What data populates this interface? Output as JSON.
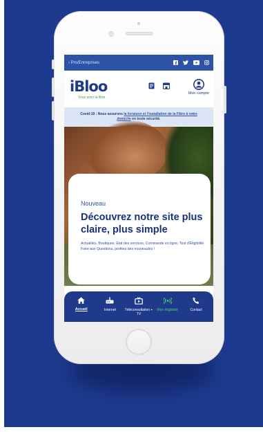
{
  "topbar": {
    "pro_link": "Pro/Entreprises",
    "socials": [
      "facebook-icon",
      "twitter-icon",
      "youtube-icon",
      "instagram-icon"
    ]
  },
  "header": {
    "logo_text": "iBloo",
    "logo_tagline": "Vous avez la fibre",
    "account_label": "Mon compte"
  },
  "covid": {
    "prefix": "Covid-19 : Nous assurons ",
    "link": "la livraison et l'installation de la Fibre à votre domicile",
    "suffix": " en toute sécurité."
  },
  "promo": {
    "kicker": "Nouveau",
    "title": "Découvrez notre site plus claire, plus simple",
    "line1": "Actualités, Boutiques, Etat des services, Commande en ligne, Test d'Eligibilité",
    "line2": "Foire aux Questions, profitez des nouveautés !"
  },
  "nav": {
    "items": [
      {
        "label": "Accueil",
        "icon": "home-icon"
      },
      {
        "label": "Internet",
        "icon": "router-icon"
      },
      {
        "label": "Téléconsultation + TV",
        "icon": "tv-icon"
      },
      {
        "label": "Mon éligibilité",
        "icon": "signal-icon"
      },
      {
        "label": "Contact",
        "icon": "phone-icon"
      }
    ]
  },
  "colors": {
    "background": "#1d3a8f",
    "brand": "#1f3a8a",
    "accent_green": "#4fcf78"
  }
}
